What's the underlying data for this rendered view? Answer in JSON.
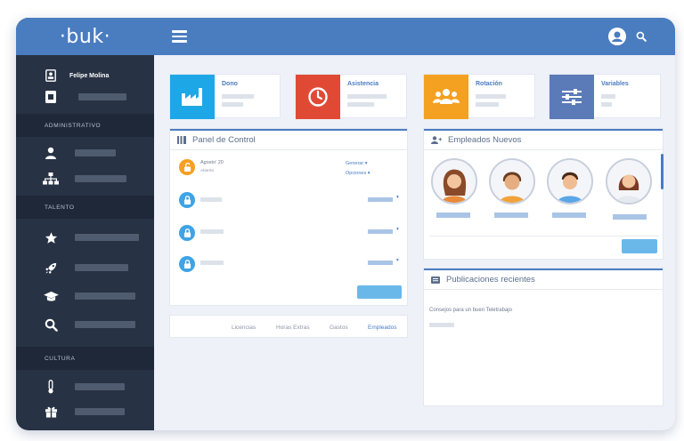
{
  "brand": {
    "logo": "·buk·"
  },
  "sidebar": {
    "user_name": "Felipe Molina",
    "sections": [
      "ADMINISTRATIVO",
      "TALENTO",
      "CULTURA"
    ]
  },
  "tiles": [
    {
      "title": "Dono",
      "icon": "factory-icon",
      "color": "#1da7e7"
    },
    {
      "title": "Asistencia",
      "icon": "clock-icon",
      "color": "#e04a35"
    },
    {
      "title": "Rotación",
      "icon": "people-group-icon",
      "color": "#f4a020"
    },
    {
      "title": "Variables",
      "icon": "sliders-icon",
      "color": "#5a7ab8"
    }
  ],
  "panel": {
    "title": "Panel de Control",
    "first_item": {
      "title": "Agosto' 20",
      "subtitle": "Abierto",
      "link1": "Generar ▾",
      "link2": "Opciones ▾"
    },
    "tabs": [
      "Licencias",
      "Horas Extras",
      "Gastos",
      "Empleados"
    ]
  },
  "employees": {
    "title": "Empleados Nuevos"
  },
  "publications": {
    "title": "Publicaciones recientes",
    "item": "Consejos para un buen Teletrabajo"
  },
  "colors": {
    "accent": "#4a7cc0",
    "sidebar": "#273244",
    "button": "#6ab8ea"
  }
}
